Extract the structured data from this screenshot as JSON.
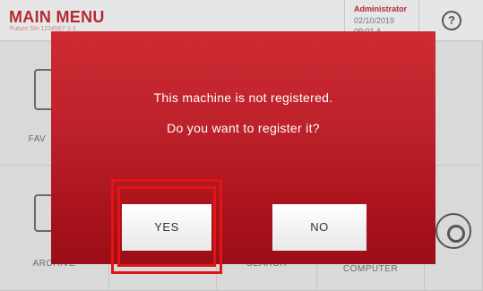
{
  "header": {
    "title": "MAIN MENU",
    "subtitle": "Future SN-1234567-1-1",
    "user_name": "Administrator",
    "date": "02/10/2019",
    "time": "09:01 A"
  },
  "help_icon": "?",
  "tiles": {
    "favorites_label": "FAV",
    "archive_label": "ARCHIVE",
    "search_label": "SEARCH",
    "computer_label": "COMPUTER"
  },
  "dialog": {
    "line1": "This machine is not registered.",
    "line2": "Do you want to register it?",
    "yes_label": "YES",
    "no_label": "NO"
  },
  "colors": {
    "dialog_top": "#ce2b33",
    "dialog_bottom": "#9b0e17",
    "brand_red": "#b72a33",
    "highlight": "#e21515"
  }
}
